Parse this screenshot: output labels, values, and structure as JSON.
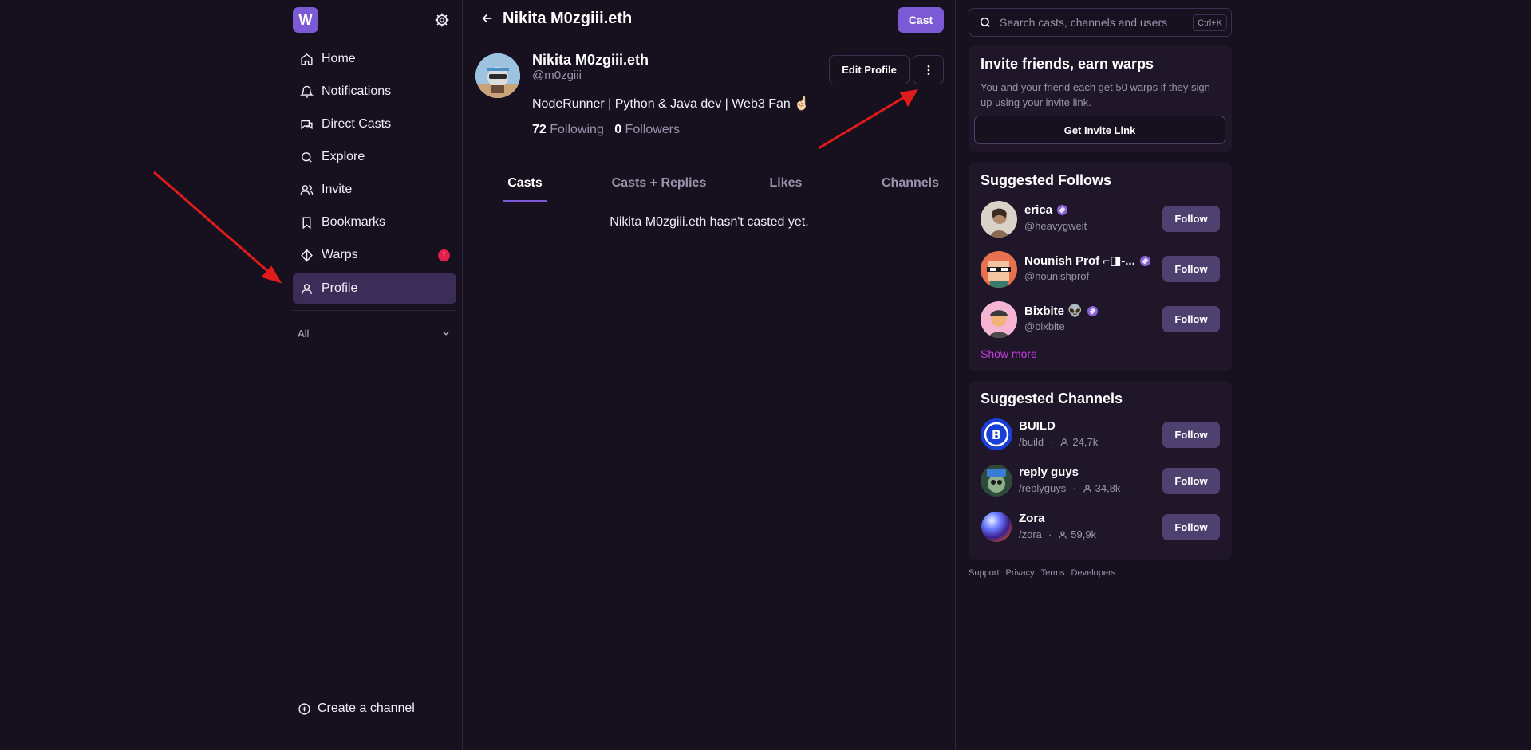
{
  "app": {
    "logo_letter": "W",
    "accent": "#7c5ad6"
  },
  "sidebar": {
    "items": [
      {
        "label": "Home",
        "icon": "home-icon"
      },
      {
        "label": "Notifications",
        "icon": "bell-icon"
      },
      {
        "label": "Direct Casts",
        "icon": "chat-icon"
      },
      {
        "label": "Explore",
        "icon": "search-icon"
      },
      {
        "label": "Invite",
        "icon": "users-icon"
      },
      {
        "label": "Bookmarks",
        "icon": "bookmark-icon"
      },
      {
        "label": "Warps",
        "icon": "diamond-icon",
        "badge": "1"
      },
      {
        "label": "Profile",
        "icon": "user-icon",
        "active": true
      }
    ],
    "filter_label": "All",
    "create_channel_label": "Create a channel"
  },
  "main": {
    "header_title": "Nikita M0zgiii.eth",
    "cast_button": "Cast",
    "profile": {
      "name": "Nikita M0zgiii.eth",
      "handle": "@m0zgiii",
      "bio": "NodeRunner | Python & Java dev | Web3 Fan ☝🏻",
      "following_count": "72",
      "following_label": "Following",
      "followers_count": "0",
      "followers_label": "Followers",
      "edit_button": "Edit Profile"
    },
    "tabs": [
      {
        "label": "Casts",
        "active": true
      },
      {
        "label": "Casts + Replies"
      },
      {
        "label": "Likes"
      },
      {
        "label": "Channels"
      }
    ],
    "empty_message": "Nikita M0zgiii.eth hasn't casted yet."
  },
  "right": {
    "search": {
      "placeholder": "Search casts, channels and users",
      "shortcut": "Ctrl+K"
    },
    "invite_card": {
      "title": "Invite friends, earn warps",
      "description": "You and your friend each get 50 warps if they sign up using your invite link.",
      "button": "Get Invite Link"
    },
    "suggested_follows": {
      "title": "Suggested Follows",
      "users": [
        {
          "name": "erica",
          "handle": "@heavygweit",
          "button": "Follow"
        },
        {
          "name": "Nounish Prof ⌐◨-...",
          "handle": "@nounishprof",
          "button": "Follow"
        },
        {
          "name": "Bixbite 👽",
          "handle": "@bixbite",
          "button": "Follow"
        }
      ],
      "show_more": "Show more"
    },
    "suggested_channels": {
      "title": "Suggested Channels",
      "channels": [
        {
          "name": "BUILD",
          "slug": "/build",
          "members": "24,7k",
          "button": "Follow"
        },
        {
          "name": "reply guys",
          "slug": "/replyguys",
          "members": "34,8k",
          "button": "Follow"
        },
        {
          "name": "Zora",
          "slug": "/zora",
          "members": "59,9k",
          "button": "Follow"
        }
      ]
    },
    "footer": [
      "Support",
      "Privacy",
      "Terms",
      "Developers"
    ],
    "dot_separator": "·"
  }
}
